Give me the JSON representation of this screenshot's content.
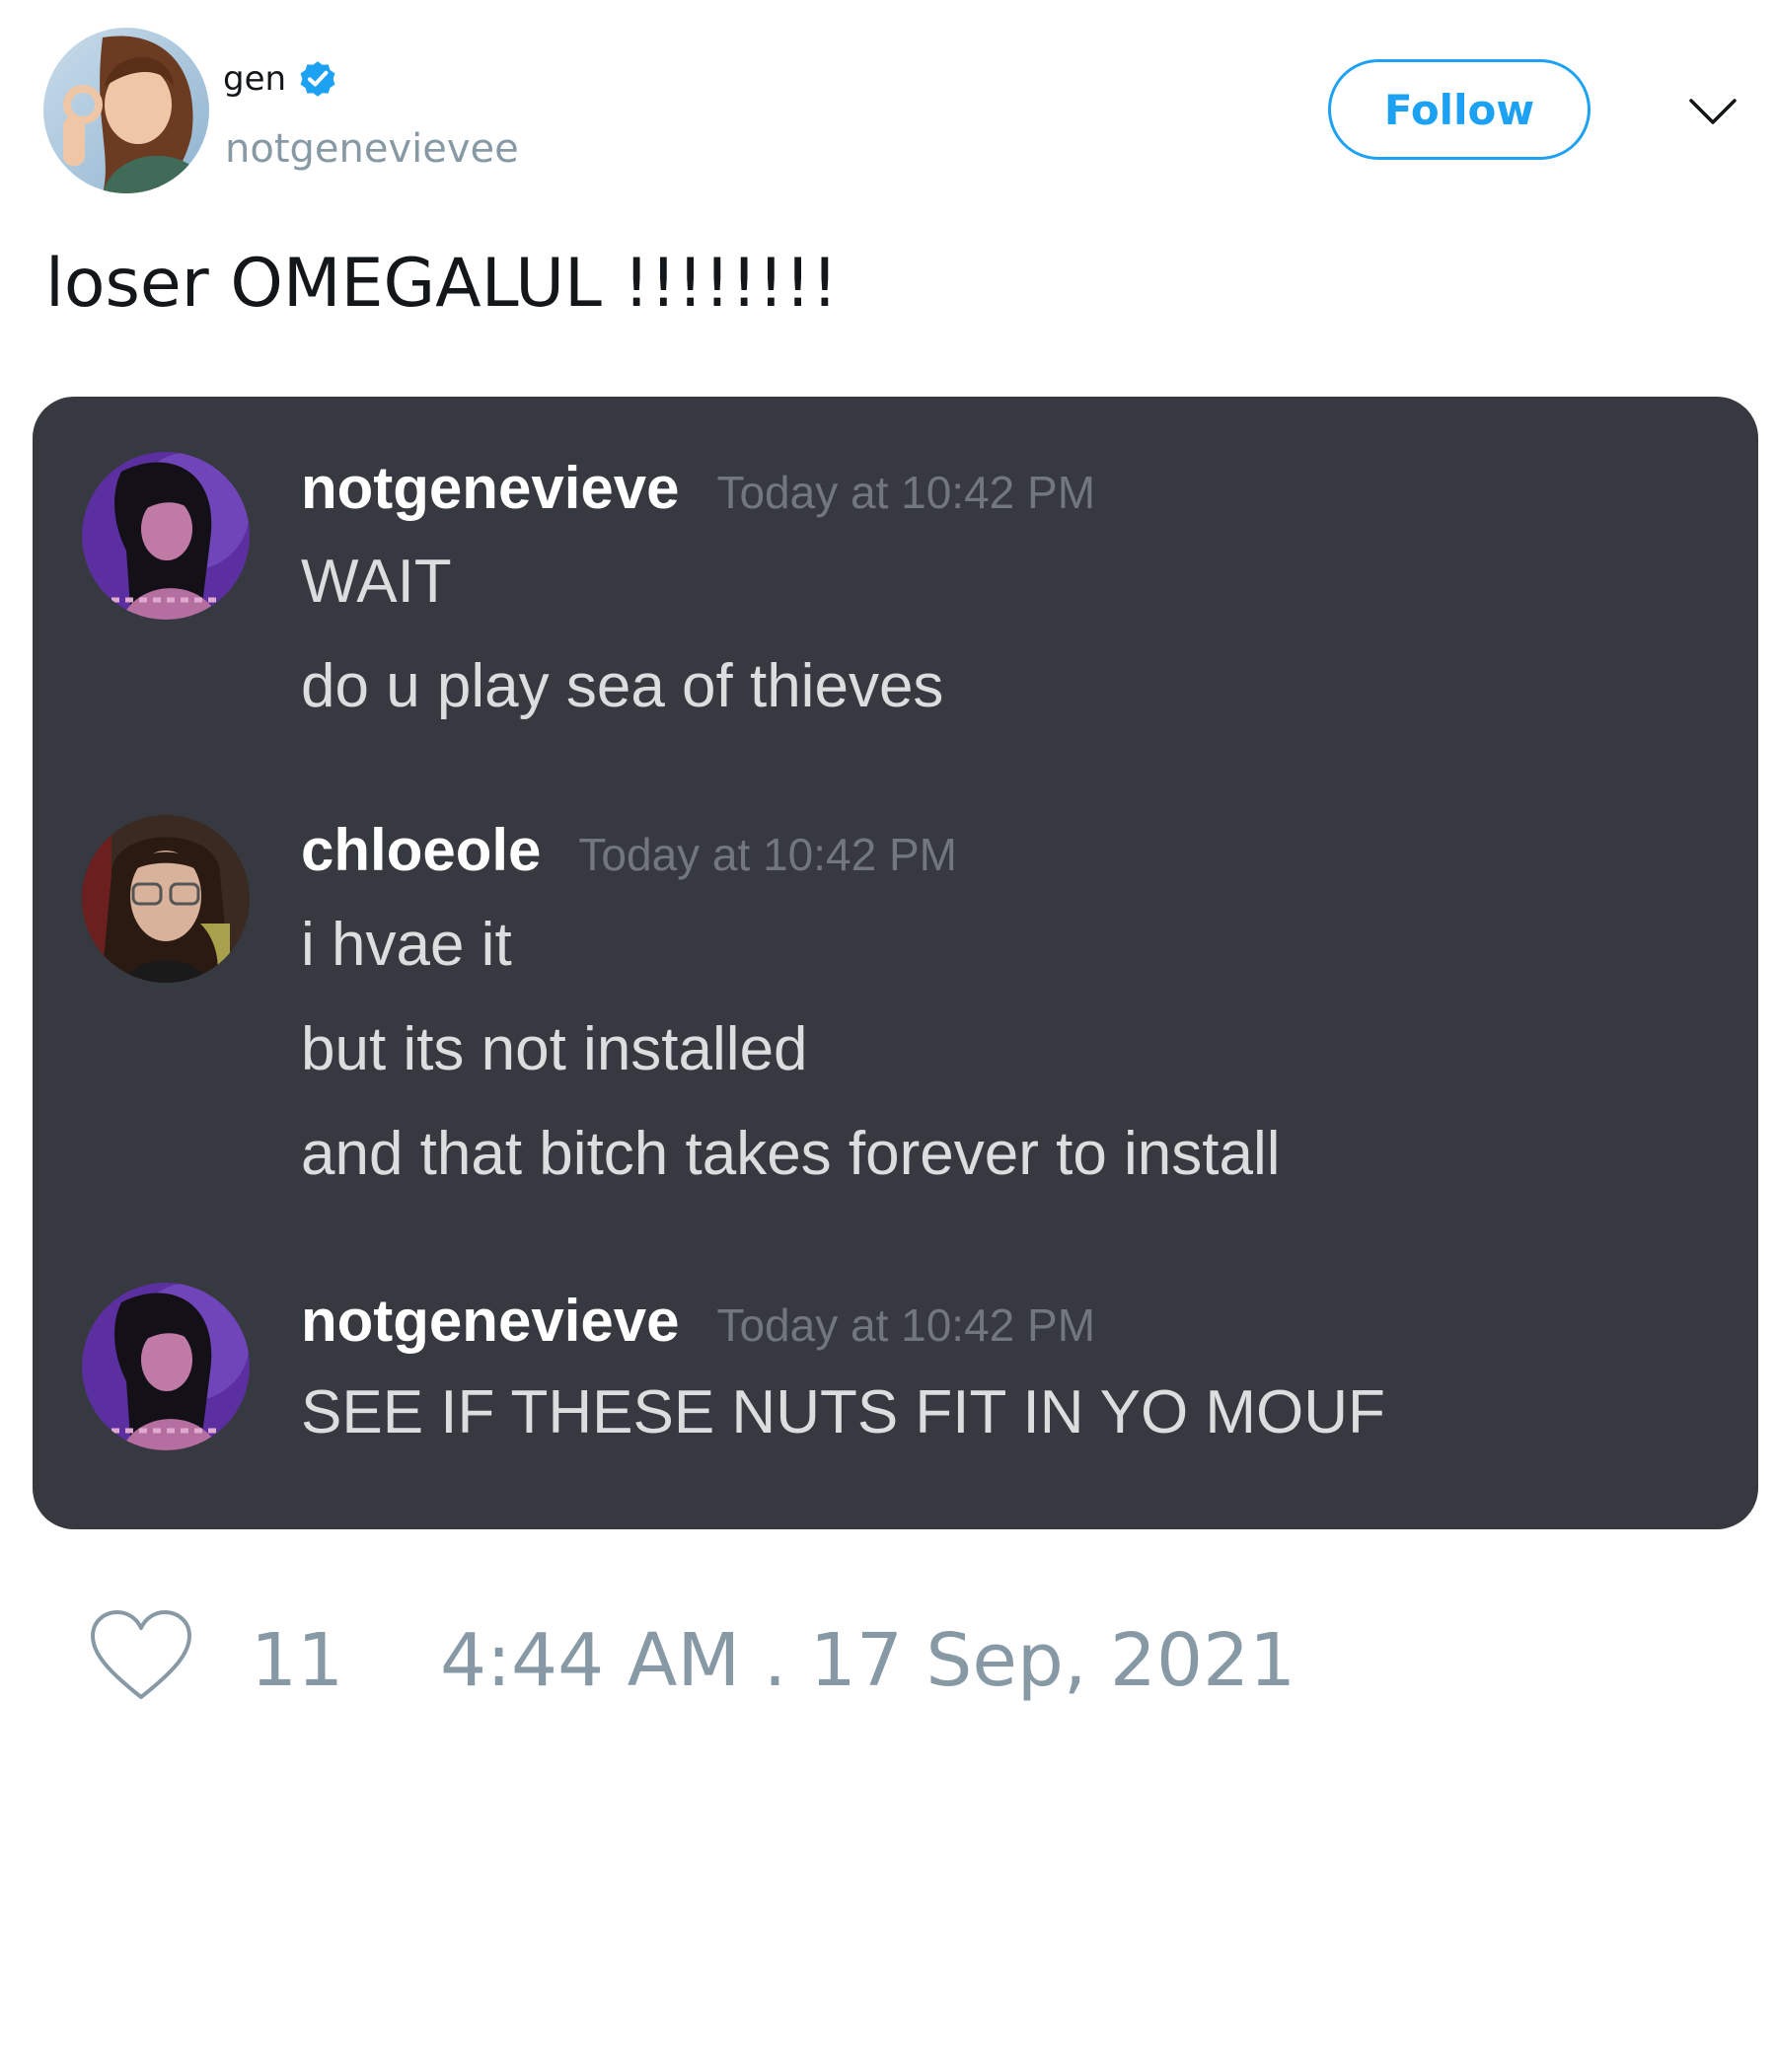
{
  "tweet": {
    "author": {
      "display_name": "gen",
      "handle": "notgenevievee",
      "verified_icon": "verified-badge-icon"
    },
    "follow_label": "Follow",
    "menu_icon": "chevron-down-icon",
    "text": "loser OMEGALUL !!!!!!!!",
    "likes": "11",
    "timestamp": "4:44 AM . 17 Sep, 2021"
  },
  "discord": {
    "messages": [
      {
        "user": "notgenevieve",
        "time": "Today at 10:42 PM",
        "lines": [
          "WAIT",
          "do u play sea of thieves"
        ]
      },
      {
        "user": "chloeole",
        "time": "Today at 10:42 PM",
        "lines": [
          "i hvae it",
          "but its not installed",
          "and that bitch takes forever to install"
        ]
      },
      {
        "user": "notgenevieve",
        "time": "Today at 10:42 PM",
        "lines": [
          "SEE IF THESE NUTS FIT IN YO MOUF"
        ]
      }
    ]
  },
  "colors": {
    "twitter_blue": "#1da1f2",
    "muted_gray": "#8899a6",
    "discord_bg": "#36393f",
    "discord_text": "#dcddde",
    "discord_time": "#72767d"
  }
}
